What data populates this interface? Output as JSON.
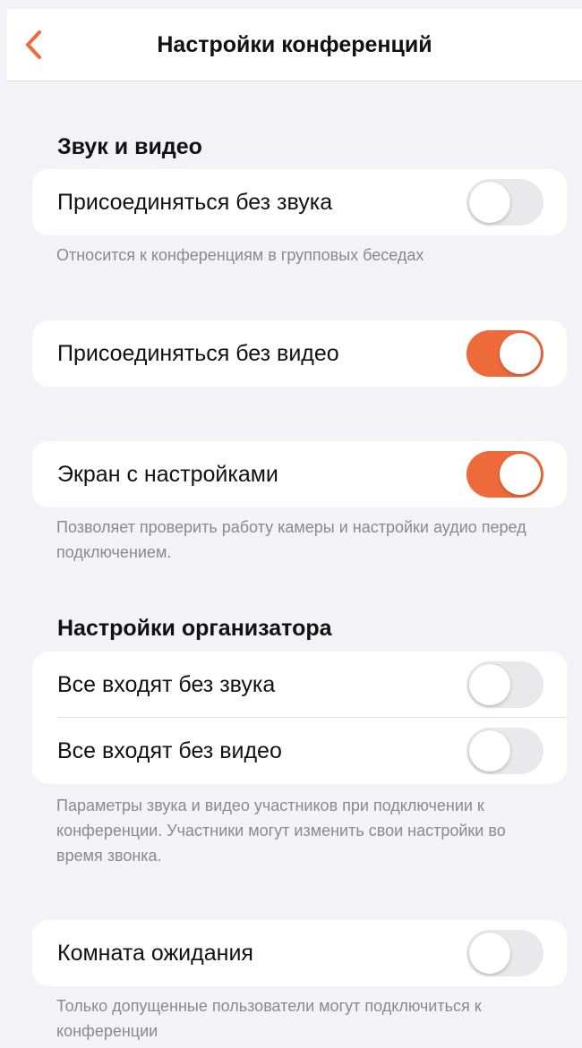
{
  "header": {
    "title": "Настройки конференций",
    "back_icon": "chevron-left-icon",
    "accent_color": "#ee6a3b"
  },
  "sections": {
    "sound_video": {
      "title": "Звук и видео",
      "join_muted": {
        "label": "Присоединяться без звука",
        "on": false
      },
      "join_muted_note": "Относится к конференциям в групповых беседах",
      "join_no_video": {
        "label": "Присоединяться без видео",
        "on": true
      },
      "settings_screen": {
        "label": "Экран с настройками",
        "on": true
      },
      "settings_screen_note": "Позволяет проверить работу камеры и настройки аудио перед подключением."
    },
    "organizer": {
      "title": "Настройки организатора",
      "all_muted": {
        "label": "Все входят без звука",
        "on": false
      },
      "all_no_video": {
        "label": "Все входят без видео",
        "on": false
      },
      "note": "Параметры звука и видео участников при подключении к конференции. Участники могут изменить свои настройки во время звонка.",
      "waiting_room": {
        "label": "Комната ожидания",
        "on": false
      },
      "waiting_room_note": "Только допущенные пользователи могут подключиться к конференции"
    }
  }
}
